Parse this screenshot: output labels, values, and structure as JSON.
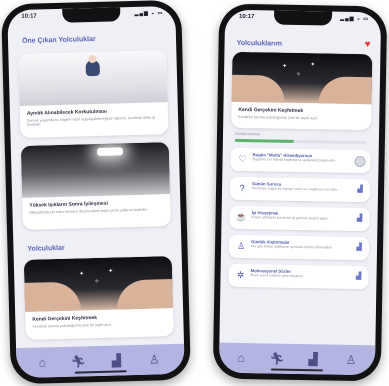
{
  "colors": {
    "accent": "#5b63b8",
    "heart": "#e53935",
    "nav_bg": "#b3b4e2",
    "progress": "#5eb26b"
  },
  "left_phone": {
    "status_time": "10:17",
    "section_featured": "Öne Çıkan Yolculuklar",
    "cards": [
      {
        "title": "Aynılık Alınabilecek Korkutulması",
        "desc": "Gerçek yaşamda bu bilgileri nasıl uygulayabileceğinizi öğrenin, kendinizi daha iyi hissedin."
      },
      {
        "title": "Yüksek Işıkların Sonra İyileşmesi",
        "desc": "Bilinçaltında yer eden olumsuz düşüncelerle başa çıkma yollarını keşfedin."
      }
    ],
    "section_journeys": "Yolculuklar",
    "journey_card": {
      "title": "Kendi Gerçekini Keşfetmek",
      "desc": "Kendinizi tanıma yolculuğunda yeni bir sayfa açın."
    },
    "nav": [
      "home-icon",
      "run-icon",
      "stats-icon",
      "profile-icon"
    ]
  },
  "right_phone": {
    "status_time": "10:17",
    "title": "Yolculuklarım",
    "hero_card": {
      "title": "Kendi Gerçekini Keşfetmek",
      "desc": "Kendinizi tanıma yolculuğunda yeni bir sayfa açın."
    },
    "progress_label": "Günlük ilerleme",
    "progress_value": 0.45,
    "rows": [
      {
        "icon": "heart-icon",
        "glyph": "♡",
        "title": "Bugün \"Mutlu\" Hissediyorsun",
        "desc": "Bugünkü ruh halinizi kaydedin ve gelişiminizi takip edin.",
        "action": "toggle"
      },
      {
        "icon": "question-icon",
        "glyph": "?",
        "title": "Günün Sorusu",
        "desc": "Kendinize bugün bu soruyu sorun ve cevabınızı not edin.",
        "action": "chart"
      },
      {
        "icon": "mug-icon",
        "glyph": "☕",
        "title": "İyi Hissetmek",
        "desc": "Küçük adımlarla kendinize iyi gelecek şeyleri yapın.",
        "action": "chart"
      },
      {
        "icon": "person-icon",
        "glyph": "♙",
        "title": "Günlük Alıştırmalar",
        "desc": "Her gün birkaç dakikanızı ayırarak zihninizi dinlendirin.",
        "action": "chart"
      },
      {
        "icon": "spark-icon",
        "glyph": "✲",
        "title": "Motivasyonel Sözler",
        "desc": "İlham veren sözlerle güne başlayın.",
        "action": "chart"
      }
    ],
    "nav": [
      "home-icon",
      "run-icon",
      "stats-icon",
      "profile-icon"
    ]
  }
}
